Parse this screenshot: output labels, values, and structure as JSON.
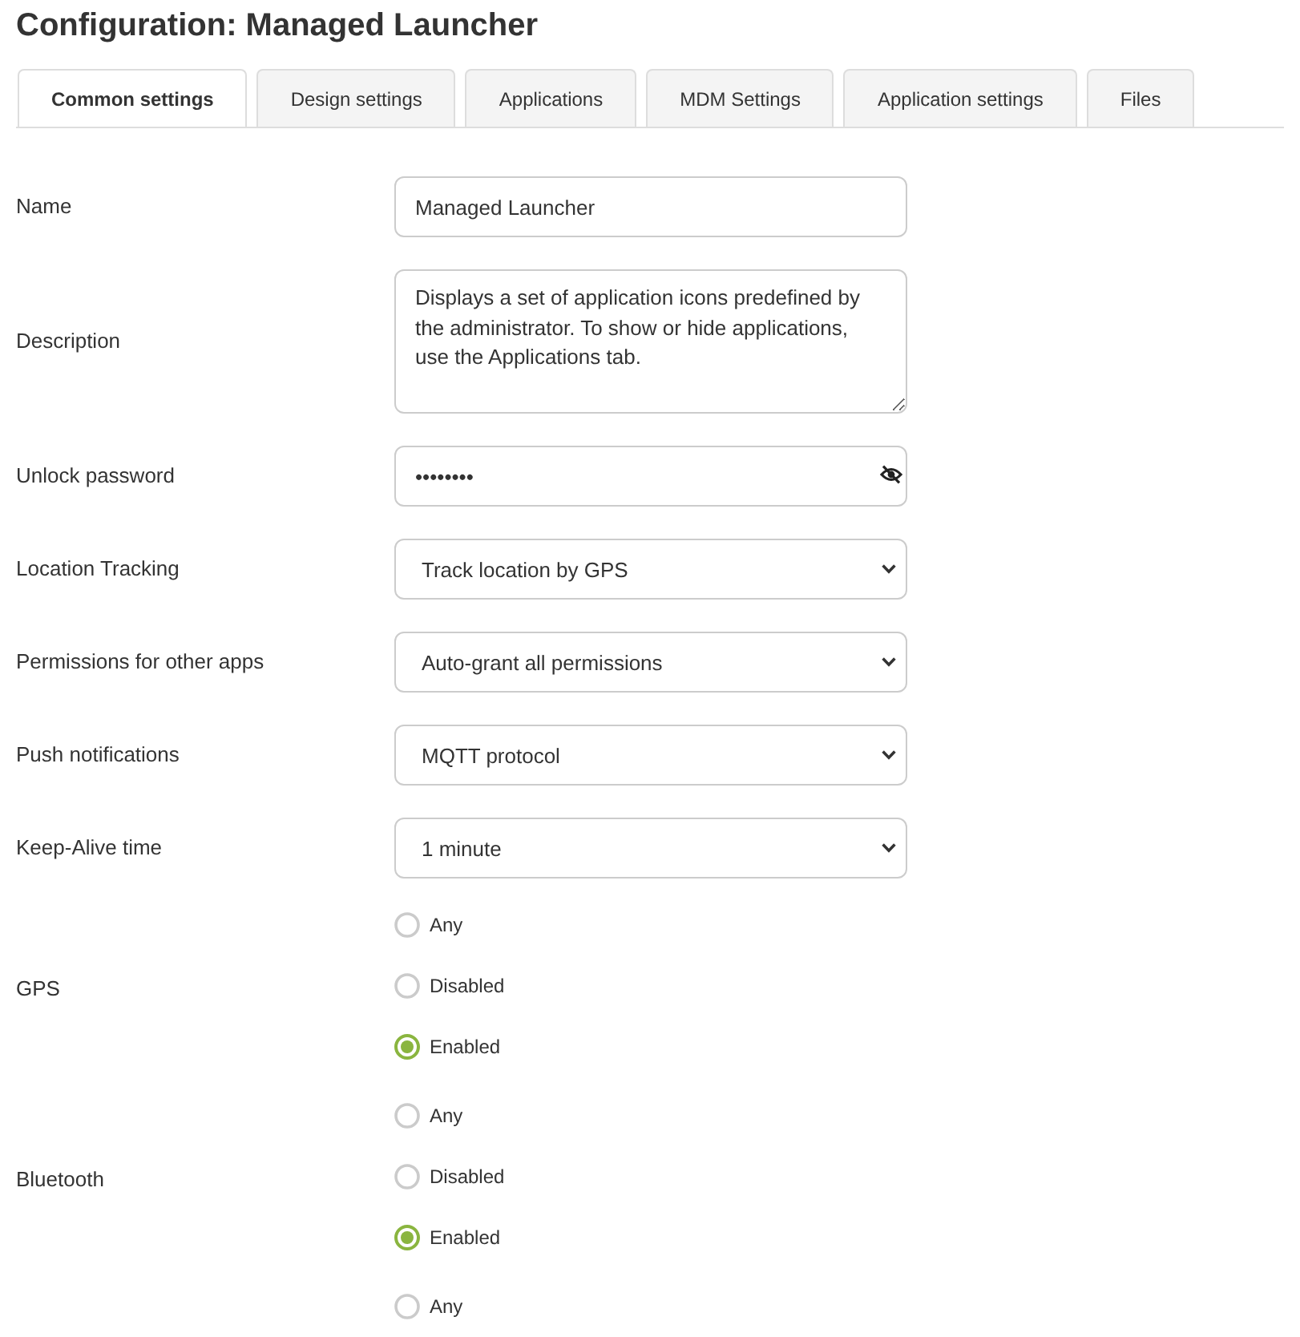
{
  "title": "Configuration: Managed Launcher",
  "tabs": [
    {
      "label": "Common settings",
      "selected": true
    },
    {
      "label": "Design settings",
      "selected": false
    },
    {
      "label": "Applications",
      "selected": false
    },
    {
      "label": "MDM Settings",
      "selected": false
    },
    {
      "label": "Application settings",
      "selected": false
    },
    {
      "label": "Files",
      "selected": false
    }
  ],
  "fields": [
    {
      "kind": "text",
      "label": "Name",
      "value": "Managed Launcher"
    },
    {
      "kind": "textarea",
      "label": "Description",
      "value": "Displays a set of application icons predefined by the administrator. To show or hide applications, use the Applications tab."
    },
    {
      "kind": "password",
      "label": "Unlock password",
      "value": "••••••••"
    },
    {
      "kind": "select",
      "label": "Location Tracking",
      "value": "Track location by GPS"
    },
    {
      "kind": "select",
      "label": "Permissions for other apps",
      "value": "Auto-grant all permissions"
    },
    {
      "kind": "select",
      "label": "Push notifications",
      "value": "MQTT protocol"
    },
    {
      "kind": "select",
      "label": "Keep-Alive time",
      "value": "1 minute"
    }
  ],
  "radio_groups": [
    {
      "label": "GPS",
      "options": [
        {
          "label": "Any",
          "selected": false
        },
        {
          "label": "Disabled",
          "selected": false
        },
        {
          "label": "Enabled",
          "selected": true
        }
      ]
    },
    {
      "label": "Bluetooth",
      "options": [
        {
          "label": "Any",
          "selected": false
        },
        {
          "label": "Disabled",
          "selected": false
        },
        {
          "label": "Enabled",
          "selected": true
        }
      ]
    },
    {
      "options": [
        {
          "label": "Any",
          "selected": false
        }
      ]
    }
  ]
}
